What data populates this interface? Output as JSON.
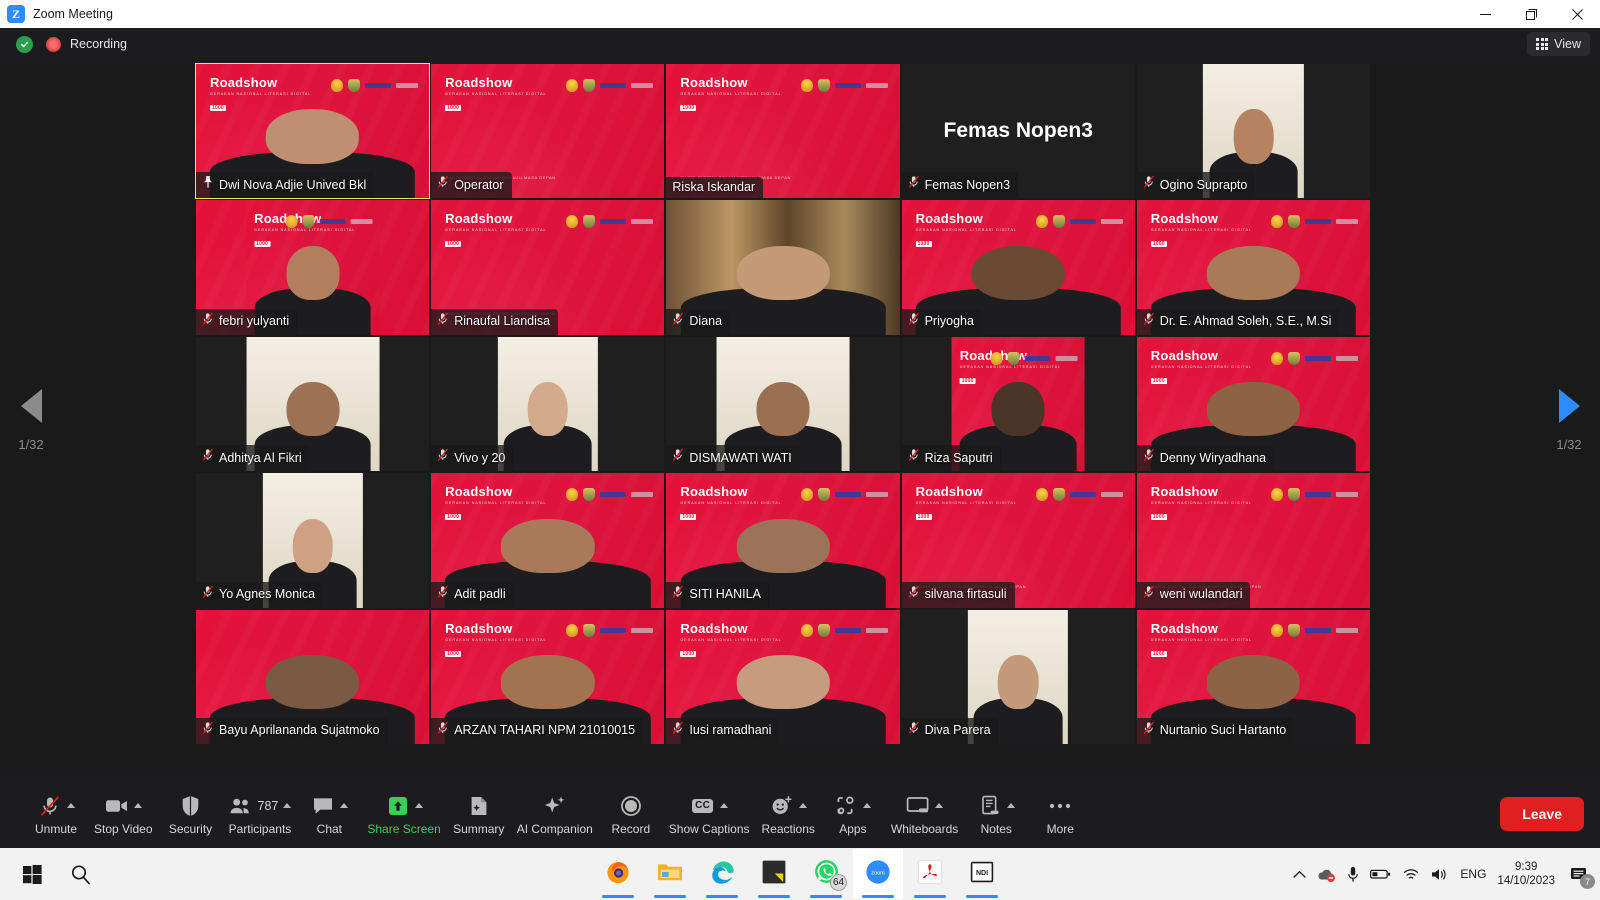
{
  "window": {
    "app_icon": "zoom-logo-icon",
    "title": "Zoom Meeting",
    "minimize": "minimize-icon",
    "maximize": "maximize-icon",
    "close": "close-icon"
  },
  "header": {
    "encryption_icon": "shield-check-icon",
    "recording_icon": "recording-dot-icon",
    "recording_label": "Recording",
    "view_icon": "grid-view-icon",
    "view_label": "View"
  },
  "pagination": {
    "prev_icon": "chevron-left-icon",
    "next_icon": "chevron-right-icon",
    "left_counter": "1/32",
    "right_counter": "1/32"
  },
  "colors": {
    "banner_red": "#e4123a",
    "active_outline": "#d8ef5b",
    "leave_red": "#e02020",
    "share_green": "#37d057",
    "accent_blue": "#2D8CFF"
  },
  "tiles": [
    {
      "name": "Dwi Nova Adjie Unived Bkl",
      "bg": "banner",
      "active": true,
      "status": "pin",
      "media": "person",
      "tone": "#c08f72",
      "banner": true,
      "frame": "full"
    },
    {
      "name": "Operator",
      "bg": "banner",
      "active": false,
      "status": "muted",
      "media": "none",
      "tone": "",
      "banner": true,
      "frame": "full"
    },
    {
      "name": "Riska Iskandar",
      "bg": "banner",
      "active": false,
      "status": "none",
      "media": "none",
      "tone": "",
      "banner": true,
      "frame": "full"
    },
    {
      "name": "Femas Nopen3",
      "bg": "dark",
      "active": false,
      "status": "muted",
      "media": "label",
      "tone": "",
      "banner": false,
      "frame": "full"
    },
    {
      "name": "Ogino Suprapto",
      "bg": "dark",
      "active": false,
      "status": "muted",
      "media": "person",
      "tone": "#b5835f",
      "banner": false,
      "frame": "portrait"
    },
    {
      "name": "febri yulyanti",
      "bg": "banner",
      "active": false,
      "status": "muted",
      "media": "person",
      "tone": "#b27f5e",
      "banner": true,
      "frame": "portrait-wide"
    },
    {
      "name": "Rinaufal Liandisa",
      "bg": "banner",
      "active": false,
      "status": "muted",
      "media": "none",
      "tone": "",
      "banner": true,
      "frame": "full"
    },
    {
      "name": "Diana",
      "bg": "wood",
      "active": false,
      "status": "muted",
      "media": "person",
      "tone": "#c49a78",
      "banner": false,
      "frame": "full"
    },
    {
      "name": "Priyogha",
      "bg": "banner",
      "active": false,
      "status": "muted",
      "media": "person",
      "tone": "#6b4a33",
      "banner": true,
      "frame": "full"
    },
    {
      "name": "Dr. E. Ahmad Soleh, S.E., M.Si",
      "bg": "banner",
      "active": false,
      "status": "muted",
      "media": "person",
      "tone": "#a97a57",
      "banner": true,
      "frame": "full"
    },
    {
      "name": "Adhitya Al Fikri",
      "bg": "dark",
      "active": false,
      "status": "muted",
      "media": "person",
      "tone": "#9d7252",
      "banner": false,
      "frame": "portrait-wide"
    },
    {
      "name": "Vivo y 20",
      "bg": "dark",
      "active": false,
      "status": "muted",
      "media": "person",
      "tone": "#d3aa8c",
      "banner": false,
      "frame": "portrait"
    },
    {
      "name": "DISMAWATI WATI",
      "bg": "dark",
      "active": false,
      "status": "muted",
      "media": "person",
      "tone": "#9b7050",
      "banner": false,
      "frame": "portrait-wide"
    },
    {
      "name": "Riza Saputri",
      "bg": "dark",
      "active": false,
      "status": "muted",
      "media": "person",
      "tone": "#4a3526",
      "banner": true,
      "frame": "portrait-wide"
    },
    {
      "name": "Denny Wiryadhana",
      "bg": "banner",
      "active": false,
      "status": "muted",
      "media": "person",
      "tone": "#8d6343",
      "banner": true,
      "frame": "full"
    },
    {
      "name": "Yo Agnes Monica",
      "bg": "dark",
      "active": false,
      "status": "muted",
      "media": "person",
      "tone": "#cfa184",
      "banner": false,
      "frame": "portrait"
    },
    {
      "name": "Adit padli",
      "bg": "banner",
      "active": false,
      "status": "muted",
      "media": "person",
      "tone": "#a9795a",
      "banner": true,
      "frame": "full"
    },
    {
      "name": "SITI HANILA",
      "bg": "banner",
      "active": false,
      "status": "muted",
      "media": "person",
      "tone": "#9c7358",
      "banner": true,
      "frame": "full"
    },
    {
      "name": "silvana firtasuli",
      "bg": "banner",
      "active": false,
      "status": "muted",
      "media": "none",
      "tone": "",
      "banner": true,
      "frame": "full"
    },
    {
      "name": "weni wulandari",
      "bg": "banner",
      "active": false,
      "status": "muted",
      "media": "none",
      "tone": "",
      "banner": true,
      "frame": "full"
    },
    {
      "name": "Bayu Aprilananda Sujatmoko",
      "bg": "banner",
      "active": false,
      "status": "muted",
      "media": "person",
      "tone": "#7a5a42",
      "banner": false,
      "frame": "full"
    },
    {
      "name": "ARZAN TAHARI NPM 21010015",
      "bg": "banner",
      "active": false,
      "status": "muted",
      "media": "person",
      "tone": "#a1744f",
      "banner": true,
      "frame": "full"
    },
    {
      "name": "Iusi ramadhani",
      "bg": "banner",
      "active": false,
      "status": "muted",
      "media": "person",
      "tone": "#c79b7e",
      "banner": true,
      "frame": "full"
    },
    {
      "name": "Diva Parera",
      "bg": "dark",
      "active": false,
      "status": "muted",
      "media": "person",
      "tone": "#c59a7a",
      "banner": false,
      "frame": "portrait"
    },
    {
      "name": "Nurtanio Suci Hartanto",
      "bg": "banner",
      "active": false,
      "status": "muted",
      "media": "person",
      "tone": "#8c6344",
      "banner": true,
      "frame": "full"
    }
  ],
  "banner_text": {
    "wordmark": "Roadshow",
    "tagline": "GERAKAN NASIONAL LITERASI DIGITAL",
    "badge": "1000",
    "footer": "MAKIN DIGITAL DALAM MENUJU MASA DEPAN"
  },
  "toolbar": {
    "items": [
      {
        "icon": "microphone-muted-icon",
        "label": "Unmute",
        "caret": true,
        "green": false
      },
      {
        "icon": "video-camera-icon",
        "label": "Stop Video",
        "caret": true,
        "green": false
      },
      {
        "icon": "shield-icon",
        "label": "Security",
        "caret": false,
        "green": false
      },
      {
        "icon": "participants-icon",
        "label": "Participants",
        "caret": true,
        "green": false,
        "count": "787"
      },
      {
        "icon": "chat-bubble-icon",
        "label": "Chat",
        "caret": true,
        "green": false
      },
      {
        "icon": "share-screen-icon",
        "label": "Share Screen",
        "caret": true,
        "green": true
      },
      {
        "icon": "summary-icon",
        "label": "Summary",
        "caret": false,
        "green": false
      },
      {
        "icon": "ai-companion-icon",
        "label": "AI Companion",
        "caret": false,
        "green": false
      },
      {
        "icon": "record-icon",
        "label": "Record",
        "caret": false,
        "green": false
      },
      {
        "icon": "closed-captions-icon",
        "label": "Show Captions",
        "caret": true,
        "green": false
      },
      {
        "icon": "reactions-icon",
        "label": "Reactions",
        "caret": true,
        "green": false
      },
      {
        "icon": "apps-icon",
        "label": "Apps",
        "caret": true,
        "green": false
      },
      {
        "icon": "whiteboard-icon",
        "label": "Whiteboards",
        "caret": true,
        "green": false
      },
      {
        "icon": "notes-icon",
        "label": "Notes",
        "caret": true,
        "green": false
      },
      {
        "icon": "more-dots-icon",
        "label": "More",
        "caret": false,
        "green": false
      }
    ],
    "leave_label": "Leave"
  },
  "taskbar": {
    "start_icon": "windows-start-icon",
    "search_icon": "search-icon",
    "apps": [
      {
        "icon": "firefox-icon",
        "name": "Firefox",
        "badge": "",
        "active": false
      },
      {
        "icon": "file-explorer-icon",
        "name": "File Explorer",
        "badge": "",
        "active": false
      },
      {
        "icon": "edge-icon",
        "name": "Microsoft Edge",
        "badge": "",
        "active": false
      },
      {
        "icon": "sticky-notes-icon",
        "name": "Sticky Notes",
        "badge": "",
        "active": false
      },
      {
        "icon": "whatsapp-icon",
        "name": "WhatsApp",
        "badge": "64",
        "active": false
      },
      {
        "icon": "zoom-icon",
        "name": "Zoom",
        "badge": "",
        "active": true
      },
      {
        "icon": "acrobat-icon",
        "name": "Adobe Acrobat",
        "badge": "",
        "active": false
      },
      {
        "icon": "ndi-icon",
        "name": "NDI",
        "badge": "",
        "active": false
      }
    ],
    "tray": {
      "overflow_icon": "chevron-up-icon",
      "onedrive_icon": "onedrive-icon",
      "microphone_icon": "microphone-icon",
      "battery_icon": "battery-icon",
      "wifi_icon": "wifi-icon",
      "volume_icon": "volume-icon",
      "language": "ENG",
      "time": "9:39",
      "date": "14/10/2023",
      "notification_icon": "notifications-icon",
      "notification_count": "7"
    }
  }
}
